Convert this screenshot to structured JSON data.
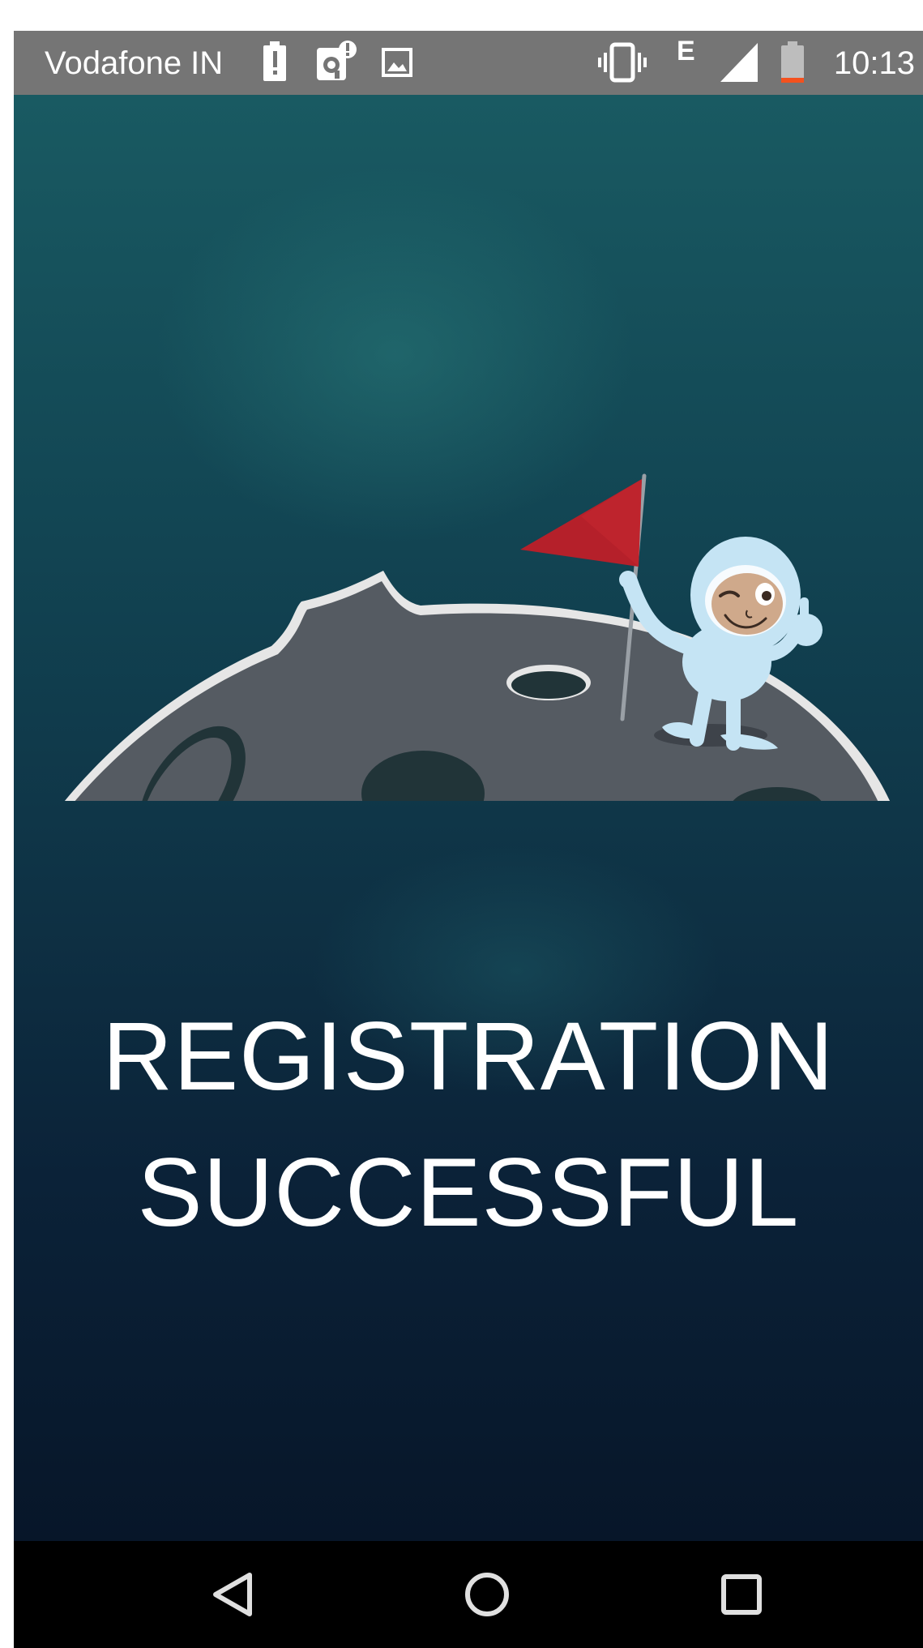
{
  "status_bar": {
    "carrier": "Vodafone IN",
    "network_type": "E",
    "time": "10:13",
    "icons": [
      "battery-alert-icon",
      "notification-alert-icon",
      "image-icon",
      "vibrate-icon",
      "network-type-icon",
      "signal-icon",
      "battery-low-icon"
    ]
  },
  "main": {
    "message_line1": "REGISTRATION",
    "message_line2": "SUCCESSFUL",
    "illustration": "astronaut-on-moon-with-red-flag"
  },
  "nav_bar": {
    "buttons": [
      "back-icon",
      "home-icon",
      "recents-icon"
    ]
  },
  "colors": {
    "status_bar": "#757575",
    "background_top": "#195a62",
    "background_bottom": "#071629",
    "moon": "#555b62",
    "moon_outline": "#e6e6e6",
    "crater": "#213438",
    "flag": "#b5202a",
    "astronaut_suit": "#c5e4f4",
    "text": "#ffffff",
    "nav_bar": "#000000"
  }
}
